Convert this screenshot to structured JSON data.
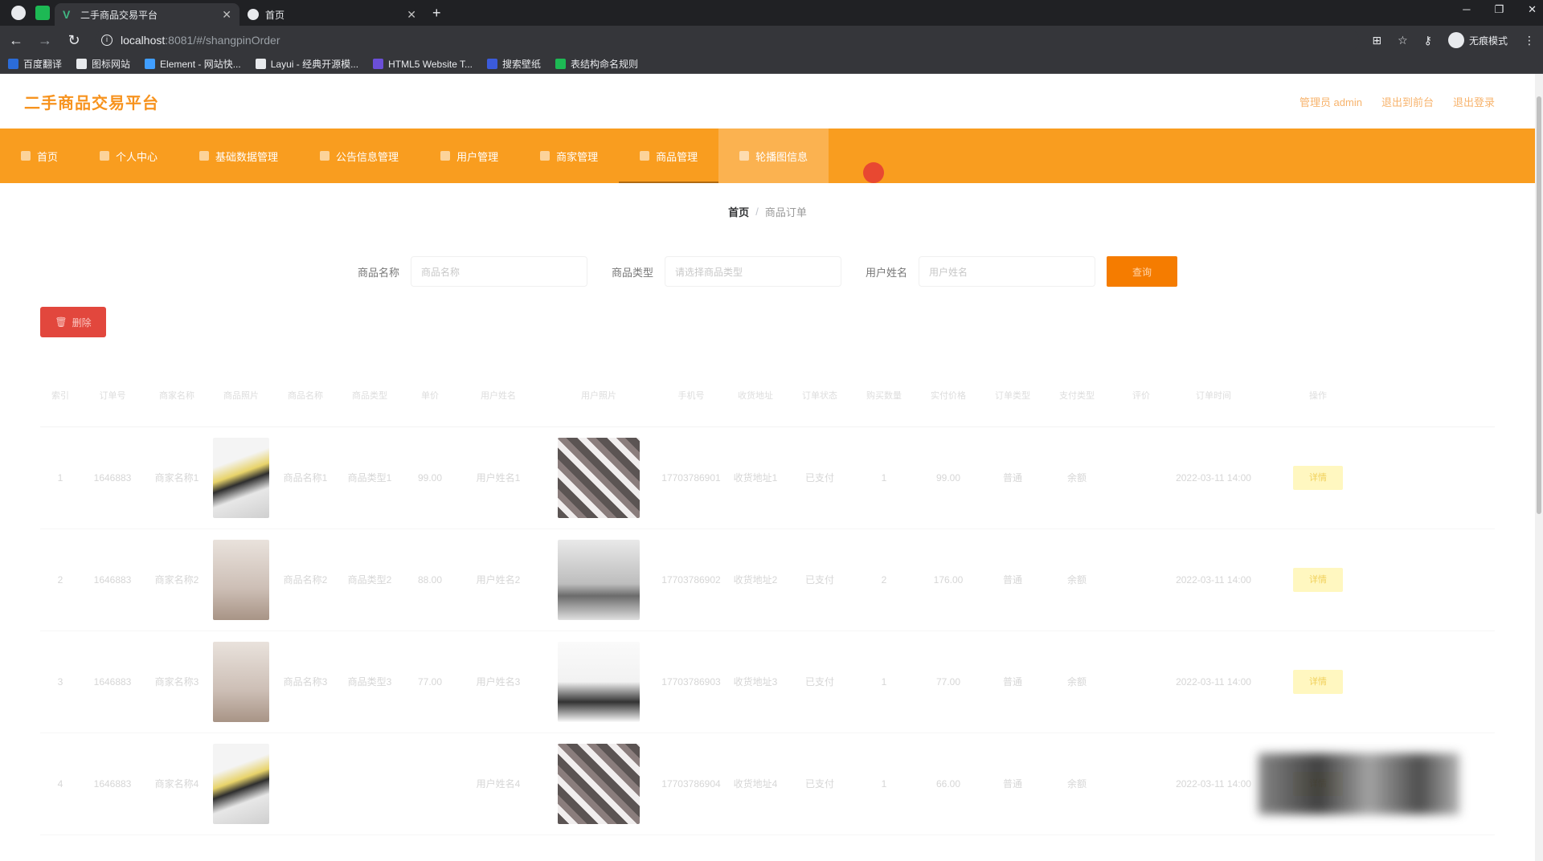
{
  "browser": {
    "tabs": [
      {
        "title": "二手商品交易平台",
        "active": true,
        "icon": "vue-icon"
      },
      {
        "title": "首页",
        "active": false,
        "icon": "globe-icon"
      }
    ],
    "url_host": "localhost",
    "url_path": ":8081/#/shangpinOrder",
    "incognito_label": "无痕模式",
    "window_controls": [
      "─",
      "❐",
      "✕"
    ],
    "bookmarks": [
      {
        "label": "百度翻译",
        "color": "#2b6cd8"
      },
      {
        "label": "图标网站",
        "color": "#e8eaed"
      },
      {
        "label": "Element - 网站快...",
        "color": "#409eff"
      },
      {
        "label": "Layui - 经典开源模...",
        "color": "#e8eaed"
      },
      {
        "label": "HTML5 Website T...",
        "color": "#6b4fd8"
      },
      {
        "label": "搜索壁纸",
        "color": "#3b5bdb"
      },
      {
        "label": "表结构命名规则",
        "color": "#1db954"
      }
    ]
  },
  "app": {
    "title": "二手商品交易平台",
    "header_links": [
      "管理员 admin",
      "退出到前台",
      "退出登录"
    ],
    "nav": [
      {
        "label": "首页",
        "state": ""
      },
      {
        "label": "个人中心",
        "state": ""
      },
      {
        "label": "基础数据管理",
        "state": ""
      },
      {
        "label": "公告信息管理",
        "state": ""
      },
      {
        "label": "用户管理",
        "state": ""
      },
      {
        "label": "商家管理",
        "state": ""
      },
      {
        "label": "商品管理",
        "state": "selected"
      },
      {
        "label": "轮播图信息",
        "state": "hover"
      }
    ],
    "breadcrumb": {
      "home": "首页",
      "separator": "/",
      "current": "商品订单"
    },
    "search": {
      "fields": [
        {
          "label": "商品名称",
          "placeholder": "商品名称"
        },
        {
          "label": "商品类型",
          "placeholder": "请选择商品类型"
        },
        {
          "label": "用户姓名",
          "placeholder": "用户姓名"
        }
      ],
      "button": "查询"
    },
    "delete_button": "删除",
    "table": {
      "headers": [
        "索引",
        "订单号",
        "商家名称",
        "商品照片",
        "商品名称",
        "商品类型",
        "单价",
        "用户姓名",
        "用户照片",
        "手机号",
        "收货地址",
        "订单状态",
        "购买数量",
        "实付价格",
        "订单类型",
        "支付类型",
        "评价",
        "订单时间",
        "操作"
      ],
      "detail_label": "详情",
      "rows": [
        {
          "index": "1",
          "order": "1646883",
          "shop": "商家名称1",
          "goods_img": "img-a",
          "goods": "商品名称1",
          "gtype": "商品类型1",
          "price": "99.00",
          "user": "用户姓名1",
          "user_img": "ph-a",
          "phone": "17703786901",
          "addr": "收货地址1",
          "status": "已支付",
          "qty": "1",
          "paid": "99.00",
          "otype": "普通",
          "ptype": "余额",
          "review": "",
          "time": "2022-03-11 14:00"
        },
        {
          "index": "2",
          "order": "1646883",
          "shop": "商家名称2",
          "goods_img": "img-b",
          "goods": "商品名称2",
          "gtype": "商品类型2",
          "price": "88.00",
          "user": "用户姓名2",
          "user_img": "ph-b",
          "phone": "17703786902",
          "addr": "收货地址2",
          "status": "已支付",
          "qty": "2",
          "paid": "176.00",
          "otype": "普通",
          "ptype": "余额",
          "review": "",
          "time": "2022-03-11 14:00"
        },
        {
          "index": "3",
          "order": "1646883",
          "shop": "商家名称3",
          "goods_img": "img-b",
          "goods": "商品名称3",
          "gtype": "商品类型3",
          "price": "77.00",
          "user": "用户姓名3",
          "user_img": "ph-c",
          "phone": "17703786903",
          "addr": "收货地址3",
          "status": "已支付",
          "qty": "1",
          "paid": "77.00",
          "otype": "普通",
          "ptype": "余额",
          "review": "",
          "time": "2022-03-11 14:00"
        },
        {
          "index": "4",
          "order": "1646883",
          "shop": "商家名称4",
          "goods_img": "img-a",
          "goods": "",
          "gtype": "",
          "price": "",
          "user": "用户姓名4",
          "user_img": "ph-a",
          "phone": "17703786904",
          "addr": "收货地址4",
          "status": "已支付",
          "qty": "1",
          "paid": "66.00",
          "otype": "普通",
          "ptype": "余额",
          "review": "",
          "time": "2022-03-11 14:00"
        }
      ]
    }
  }
}
